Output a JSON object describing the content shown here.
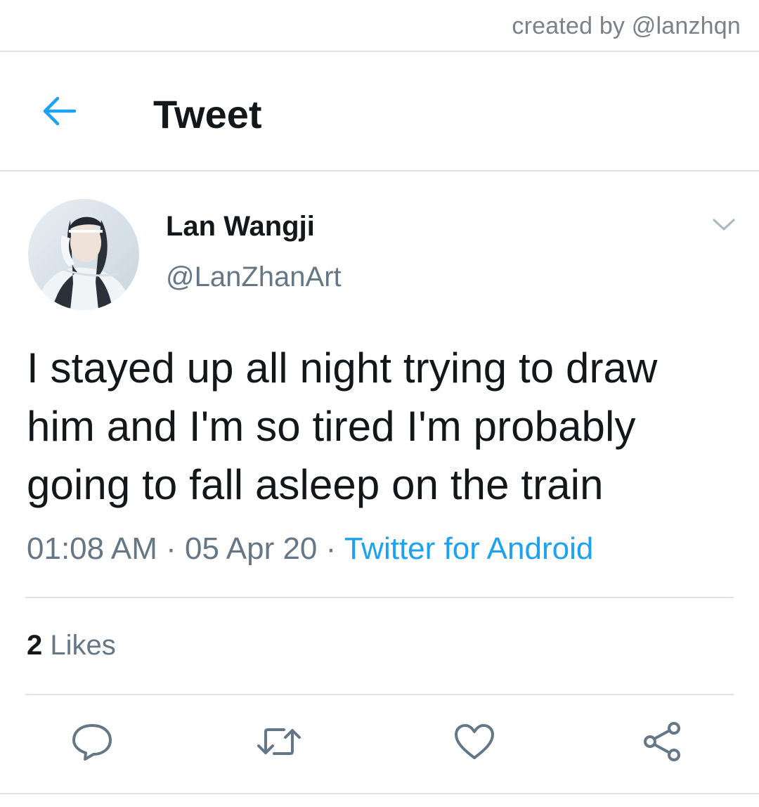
{
  "credit": "created by @lanzhqn",
  "header": {
    "title": "Tweet",
    "back_icon": "arrow-left-icon"
  },
  "author": {
    "display_name": "Lan Wangji",
    "handle": "@LanZhanArt",
    "avatar_icon": "profile-photo"
  },
  "tweet": {
    "text": "I stayed up all night trying to draw him and I'm so tired I'm probably going to fall asleep on the train",
    "time": "01:08 AM",
    "separator": "·",
    "date": "05 Apr 20",
    "source": "Twitter for Android"
  },
  "stats": {
    "likes_count": "2",
    "likes_label": "Likes"
  },
  "actions": [
    "reply-icon",
    "retweet-icon",
    "like-icon",
    "share-icon"
  ],
  "colors": {
    "accent": "#1da1f2",
    "text": "#14171a",
    "secondary": "#657786",
    "divider": "#dfe3e7"
  }
}
